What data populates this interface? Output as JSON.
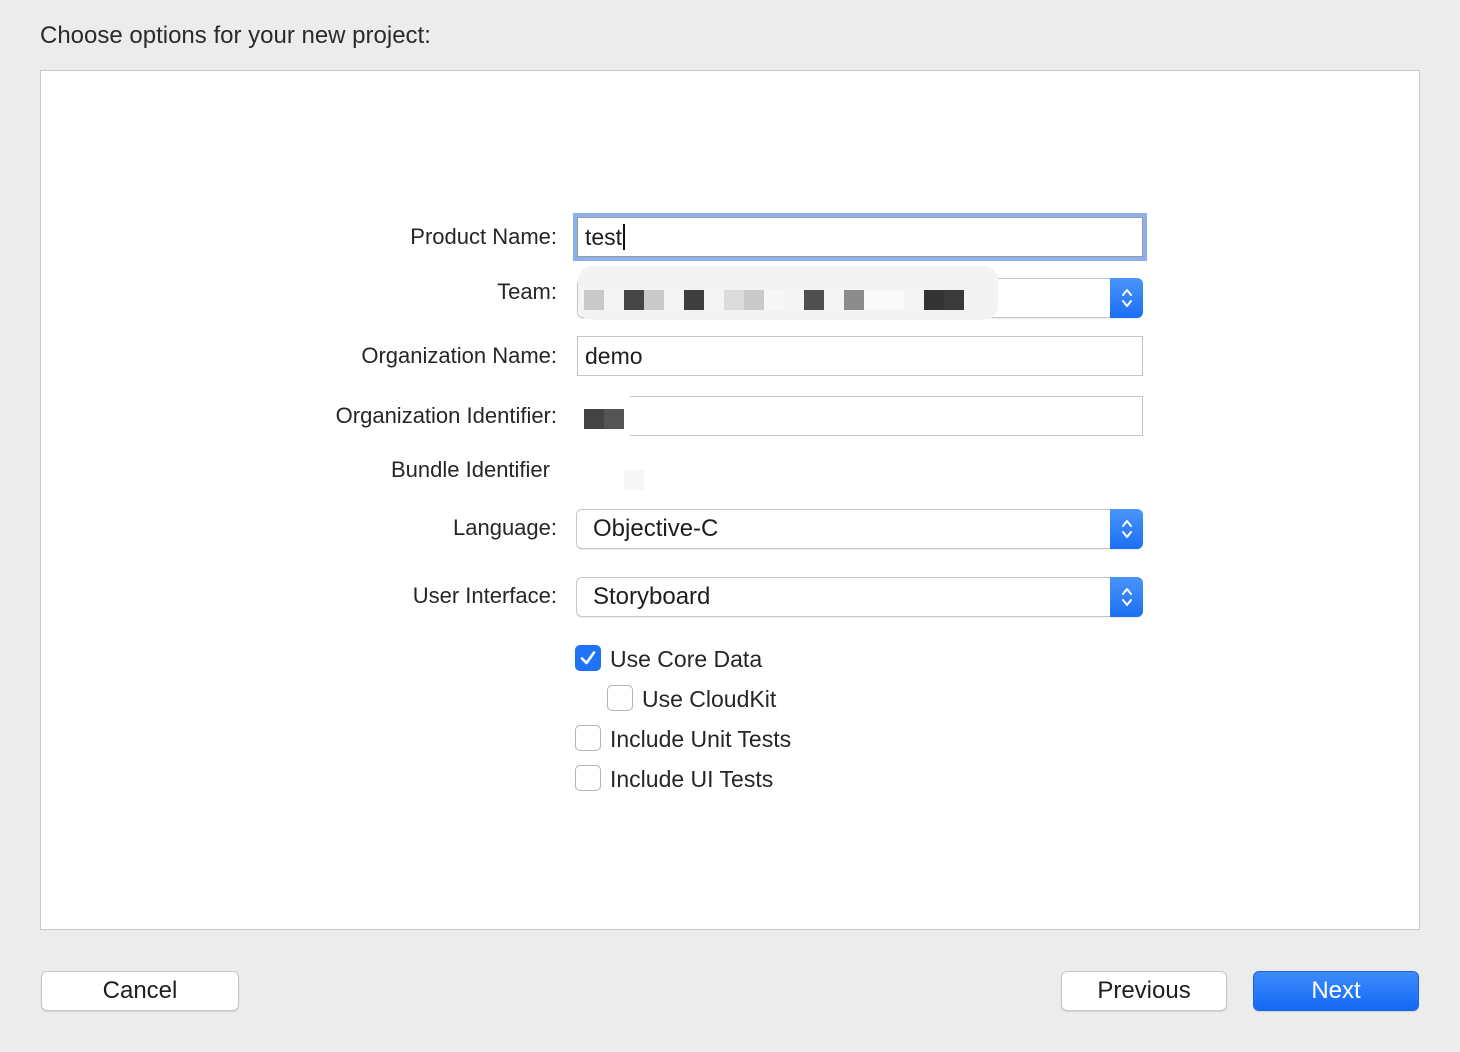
{
  "header": {
    "title": "Choose options for your new project:"
  },
  "form": {
    "product_name": {
      "label": "Product Name:",
      "value": "test"
    },
    "team": {
      "label": "Team:"
    },
    "organization_name": {
      "label": "Organization Name:",
      "value": "demo"
    },
    "organization_identifier": {
      "label": "Organization Identifier:"
    },
    "bundle_identifier": {
      "label": "Bundle Identifier"
    },
    "language": {
      "label": "Language:",
      "value": "Objective-C"
    },
    "user_interface": {
      "label": "User Interface:",
      "value": "Storyboard"
    }
  },
  "options": {
    "core_data": {
      "label": "Use Core Data",
      "checked": true
    },
    "cloudkit": {
      "label": "Use CloudKit",
      "checked": false
    },
    "unit_tests": {
      "label": "Include Unit Tests",
      "checked": false
    },
    "ui_tests": {
      "label": "Include UI Tests",
      "checked": false
    }
  },
  "footer": {
    "cancel_label": "Cancel",
    "previous_label": "Previous",
    "next_label": "Next"
  },
  "colors": {
    "accent": "#1f74f5",
    "focus_ring": "#8fb0ee",
    "window_bg": "#ececec",
    "panel_bg": "#ffffff"
  },
  "icons": {
    "popup_stepper": "chevron-up-down-icon",
    "checkbox_check": "checkmark-icon"
  }
}
